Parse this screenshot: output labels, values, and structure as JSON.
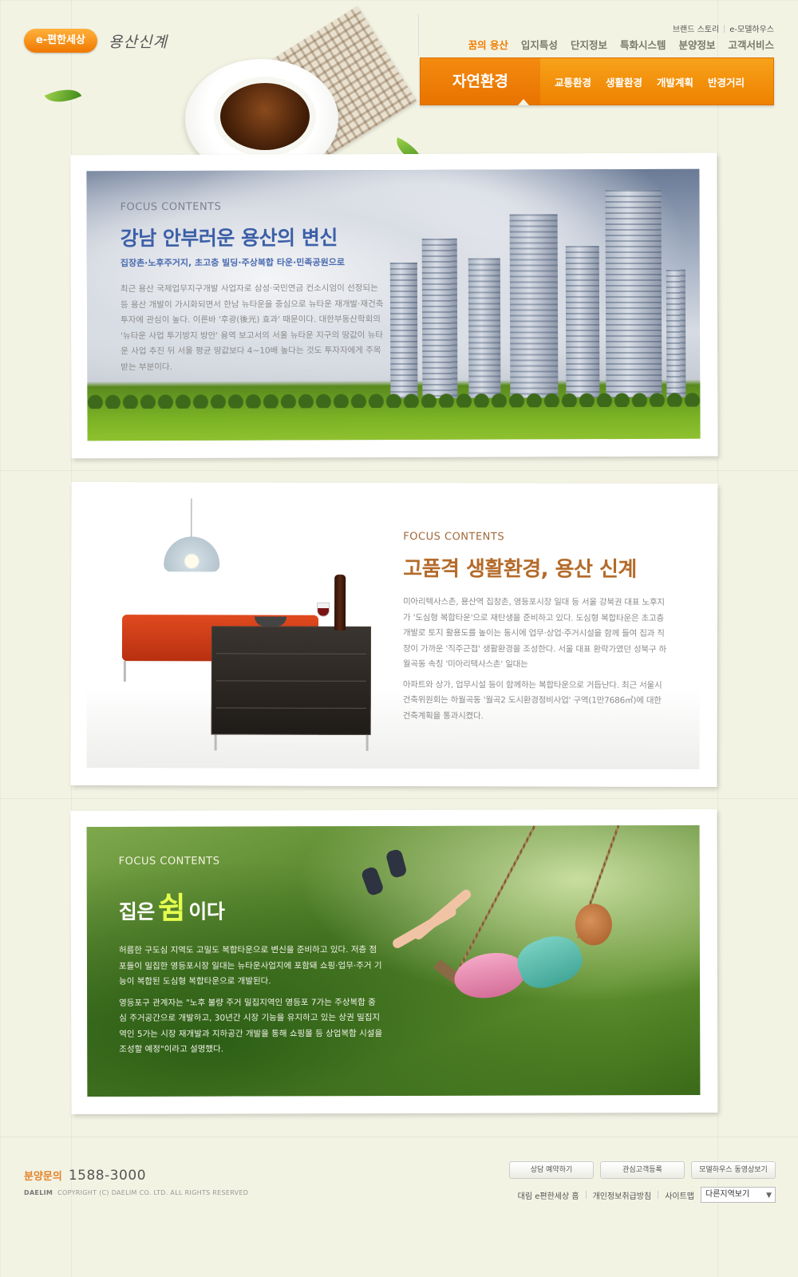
{
  "brand": {
    "logo_text": "e-편한세상",
    "site_name": "용산신계"
  },
  "util_links": [
    "브랜드 스토리",
    "e-모델하우스"
  ],
  "gnb": [
    {
      "label": "꿈의 용산",
      "active": true
    },
    {
      "label": "입지특성",
      "active": false
    },
    {
      "label": "단지정보",
      "active": false
    },
    {
      "label": "특화시스템",
      "active": false
    },
    {
      "label": "분양정보",
      "active": false
    },
    {
      "label": "고객서비스",
      "active": false
    }
  ],
  "subnav": {
    "current": "자연환경",
    "items": [
      "교통환경",
      "생활환경",
      "개발계획",
      "반경거리"
    ]
  },
  "colors": {
    "accent_orange": "#f07d00",
    "card1_title": "#3b5fa8",
    "card2_title": "#b46b2a",
    "card3_highlight": "#e6ff4f"
  },
  "cards": [
    {
      "label": "FOCUS CONTENTS",
      "title": "강남 안부러운 용산의 변신",
      "subtitle": "집장촌·노후주거지, 초고층 빌딩·주상복합 타운·민족공원으로",
      "body": "최근 용산 국제업무지구개발 사업자로 삼성·국민연금 컨소시엄이 선정되는 등 용산 개발이 가시화되면서 한남 뉴타운을 중심으로 뉴타운 재개발·재건축 투자에 관심이 높다. 이른바 '후광(後光) 효과' 때문이다. 대한부동산학회의 '뉴타운 사업 투기방지 방안' 용역 보고서의 서울 뉴타운 지구의 땅값이 뉴타운 사업 추진 뒤 서울 평균 땅값보다 4~10배 높다는 것도 투자자에게 주목받는 부분이다."
    },
    {
      "label": "FOCUS CONTENTS",
      "title": "고품격 생활환경, 용산 신계",
      "body1": "미아리텍사스촌, 용산역 집창촌, 영등포시장 일대 등 서울 강북권 대표 노후지가 '도심형 복합타운'으로 재탄생을 준비하고 있다. 도심형 복합타운은 초고층 개발로 토지 활용도를 높이는 동시에 업무·상업·주거시설을 함께 들여 집과 직장이 가까운 '직주근접' 생활환경을 조성한다. 서울 대표 환락가였던 성북구 하월곡동 속칭 '미아리텍사스촌' 일대는",
      "body2": "아파트와 상가, 업무시설 등이 함께하는 복합타운으로 거듭난다. 최근 서울시 건축위원회는 하월곡동 '월곡2 도시환경정비사업' 구역(1만7686㎡)에 대한 건축계획을 통과시켰다."
    },
    {
      "label": "FOCUS CONTENTS",
      "title_before": "집은",
      "title_highlight": "쉼",
      "title_after": "이다",
      "body1": "허름한 구도심 지역도 고밀도 복합타운으로 변신을 준비하고 있다. 저층 점포들이 밀집한 영등포시장 일대는 뉴타운사업지에 포함돼 쇼핑·업무·주거 기능이 복합된 도심형 복합타운으로 개발된다.",
      "body2": "영등포구 관계자는 \"노후 불량 주거 밀집지역인 영등포 7가는 주상복합 중심 주거공간으로 개발하고, 30년간 시장 기능을 유지하고 있는 상권 밀집지역인 5가는 시장 재개발과 지하공간 개발을 통해 쇼핑몰 등 상업복합 시설을 조성할 예정\"이라고 설명했다."
    }
  ],
  "footer": {
    "contact_label": "분양문의",
    "contact_number": "1588-3000",
    "company": "DAELIM",
    "copyright": "COPYRIGHT (C) DAELIM CO. LTD. ALL RIGHTS RESERVED",
    "buttons": [
      "상담 예약하기",
      "관심고객등록",
      "모델하우스 동영상보기"
    ],
    "links": [
      "대림 e편한세상 홈",
      "개인정보취급방침",
      "사이트맵"
    ],
    "region_select": "다른지역보기"
  }
}
